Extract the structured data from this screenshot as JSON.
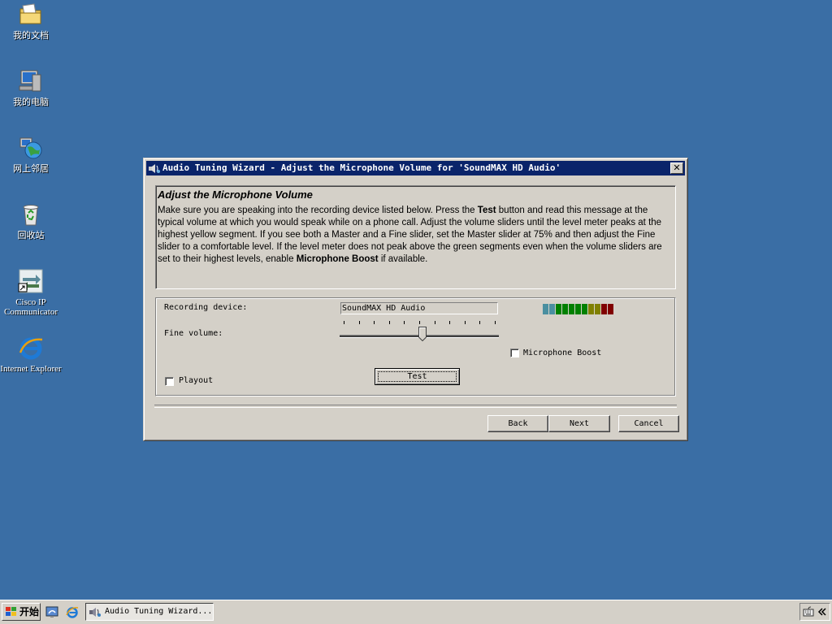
{
  "desktop": {
    "icons": [
      {
        "label": "我的文档"
      },
      {
        "label": "我的电脑"
      },
      {
        "label": "网上邻居"
      },
      {
        "label": "回收站"
      },
      {
        "label": "Cisco IP Communicator"
      },
      {
        "label": "Internet Explorer"
      }
    ]
  },
  "dialog": {
    "title": "Audio Tuning Wizard - Adjust the Microphone Volume for 'SoundMAX HD Audio'",
    "close_label": "✕",
    "heading": "Adjust the Microphone Volume",
    "instructions": {
      "p1": "Make sure you are speaking into the recording device listed below. Press the ",
      "b1": "Test",
      "p2": " button and read this message at the typical volume at which you would speak while on a phone call. Adjust the volume sliders until the level meter peaks at the highest yellow segment. If you see both a Master and a Fine slider, set the Master slider at 75% and then adjust the Fine slider to a comfortable level. If the level meter does not peak above the green segments even when the volume sliders are set to their highest levels, enable ",
      "b2": "Microphone Boost",
      "p3": " if available."
    },
    "recording_device_label": "Recording device:",
    "recording_device_value": "SoundMAX HD Audio",
    "fine_volume_label": "Fine volume:",
    "fine_volume_value": 0.52,
    "microphone_boost_label": "Microphone Boost",
    "microphone_boost_checked": false,
    "playout_label": "Playout",
    "playout_checked": false,
    "test_label": "Test",
    "back_label": "Back",
    "next_label": "Next",
    "cancel_label": "Cancel",
    "level_meter_colors": [
      "#4a8fa0",
      "#4a8fa0",
      "#008000",
      "#008000",
      "#008000",
      "#008000",
      "#008000",
      "#808000",
      "#808000",
      "#800000",
      "#800000"
    ]
  },
  "taskbar": {
    "start_label": "开始",
    "task_label": "Audio Tuning Wizard...",
    "quick_launch": [
      "show-desktop-icon",
      "internet-explorer-icon"
    ]
  },
  "colors": {
    "desktop": "#3a6ea5",
    "titlebar": "#0a246a",
    "face": "#d4d0c8"
  }
}
